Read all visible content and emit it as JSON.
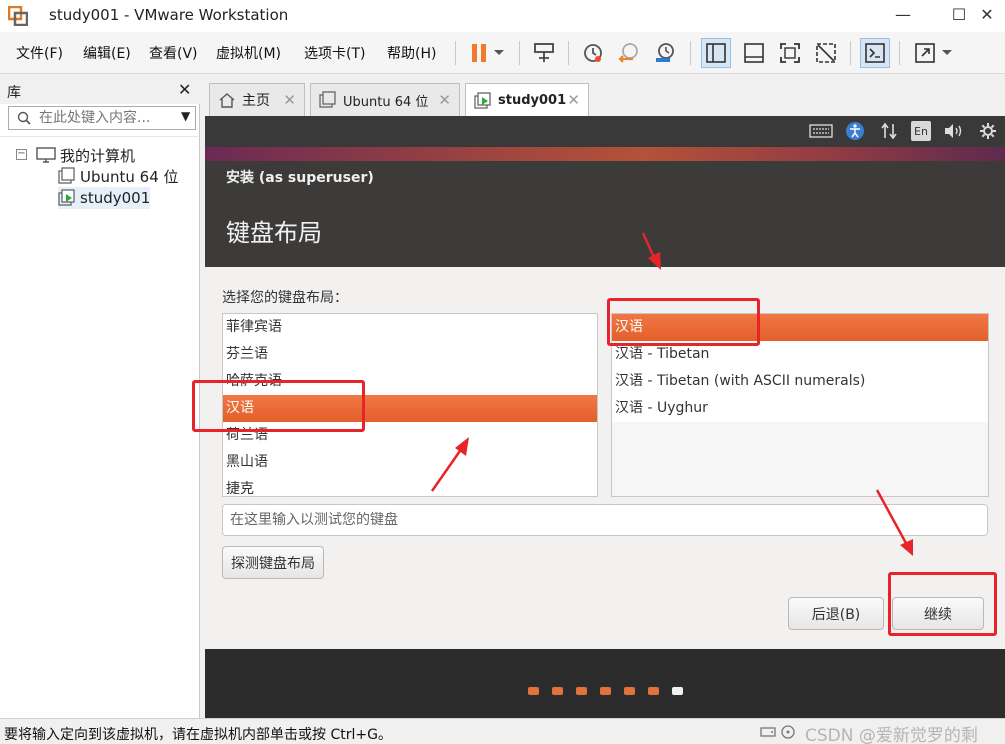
{
  "window": {
    "title": "study001 - VMware Workstation",
    "controls": {
      "minimize": "—",
      "maximize": "☐",
      "close": "✕"
    }
  },
  "menu": {
    "items": [
      "文件(F)",
      "编辑(E)",
      "查看(V)",
      "虚拟机(M)",
      "选项卡(T)",
      "帮助(H)"
    ]
  },
  "toolbar": {
    "icons": [
      "pause-icon",
      "send-ctrl-alt-del-icon",
      "snapshot-icon",
      "revert-snapshot-icon",
      "snapshot-manager-icon",
      "library-view-icon",
      "single-view-icon",
      "fullscreen-icon",
      "unity-icon",
      "console-icon",
      "stretch-icon"
    ]
  },
  "library": {
    "title": "库",
    "close": "✕",
    "search_placeholder": "在此处键入内容...",
    "root": "我的计算机",
    "vms": [
      "Ubuntu 64 位",
      "study001"
    ]
  },
  "tabs": [
    {
      "label": "主页",
      "close": "✕"
    },
    {
      "label": "Ubuntu 64 位",
      "close": "✕"
    },
    {
      "label": "study001",
      "close": "✕"
    }
  ],
  "vm_indicators": {
    "language": "En"
  },
  "installer": {
    "caption": "安装 (as superuser)",
    "title": "键盘布局",
    "choose_label": "选择您的键盘布局：",
    "layouts": [
      "菲律宾语",
      "芬兰语",
      "哈萨克语",
      "汉语",
      "荷兰语",
      "黑山语",
      "捷克"
    ],
    "selected_layout": "汉语",
    "variants": [
      "汉语",
      "汉语 - Tibetan",
      "汉语 - Tibetan (with ASCII numerals)",
      "汉语 - Uyghur"
    ],
    "selected_variant": "汉语",
    "test_placeholder": "在这里输入以测试您的键盘",
    "detect_button": "探测键盘布局",
    "back_button": "后退(B)",
    "continue_button": "继续",
    "progress": {
      "total_steps": 7,
      "current_step": 7
    }
  },
  "status": {
    "text": "要将输入定向到该虚拟机，请在虚拟机内部单击或按 Ctrl+G。",
    "watermark": "CSDN @爱新觉罗的剩"
  },
  "colors": {
    "accent": "#e95420",
    "annotation": "#e8242a"
  }
}
